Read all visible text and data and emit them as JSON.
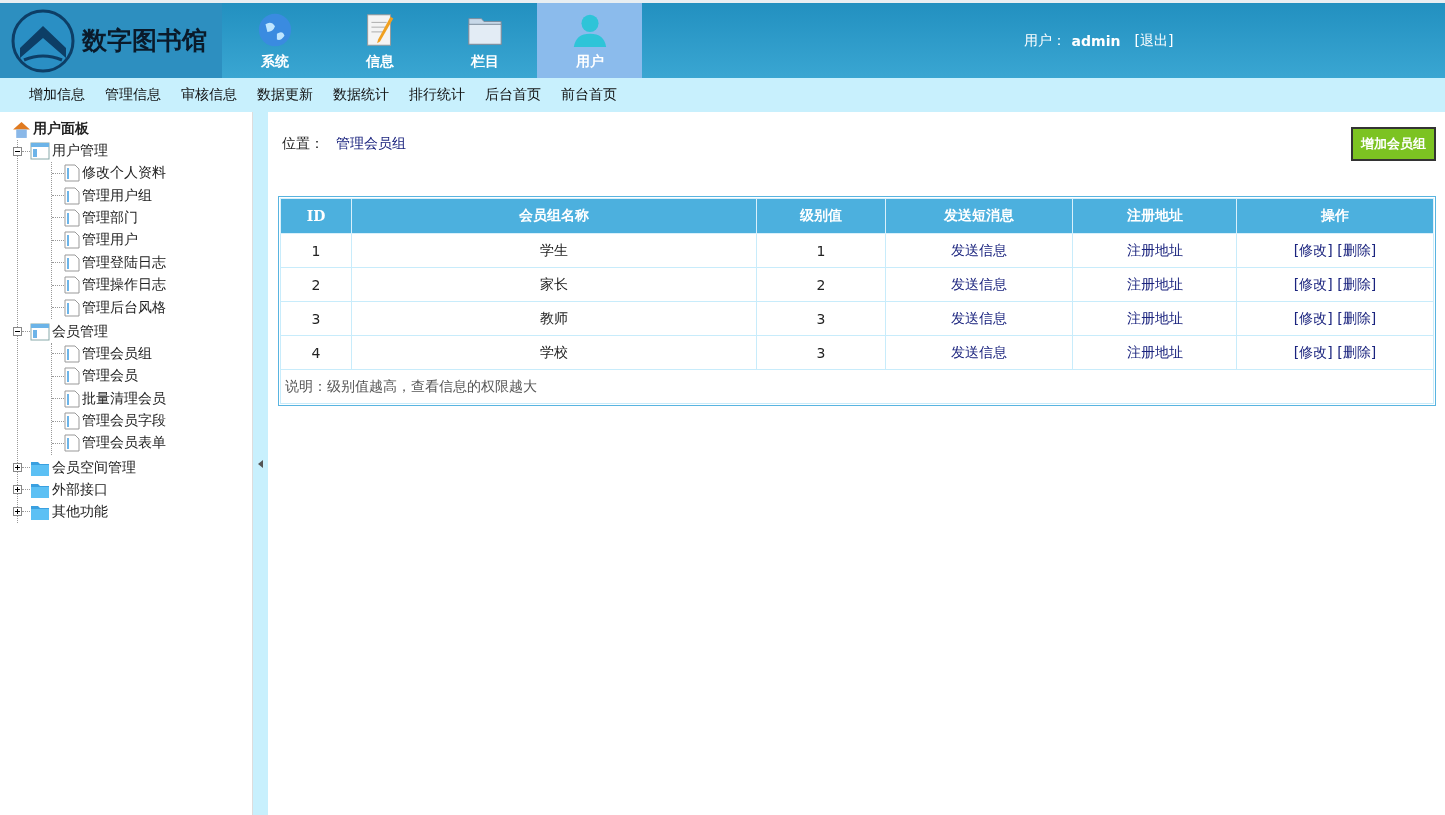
{
  "logo": {
    "title": "数字图书馆"
  },
  "tabs": [
    {
      "label": "系统",
      "kind": "globe",
      "selected": false
    },
    {
      "label": "信息",
      "kind": "note",
      "selected": false
    },
    {
      "label": "栏目",
      "kind": "folder",
      "selected": false
    },
    {
      "label": "用户",
      "kind": "user",
      "selected": true
    }
  ],
  "user": {
    "label": "用户：",
    "name": "admin",
    "logout": "[退出]"
  },
  "subnav": [
    "增加信息",
    "管理信息",
    "审核信息",
    "数据更新",
    "数据统计",
    "排行统计",
    "后台首页",
    "前台首页"
  ],
  "sidebar": {
    "title": "用户面板",
    "tree": [
      {
        "label": "用户管理",
        "kind": "panel",
        "expanded": true,
        "children": [
          {
            "label": "修改个人资料"
          },
          {
            "label": "管理用户组"
          },
          {
            "label": "管理部门"
          },
          {
            "label": "管理用户"
          },
          {
            "label": "管理登陆日志"
          },
          {
            "label": "管理操作日志"
          },
          {
            "label": "管理后台风格"
          }
        ]
      },
      {
        "label": "会员管理",
        "kind": "panel",
        "expanded": true,
        "children": [
          {
            "label": "管理会员组"
          },
          {
            "label": "管理会员"
          },
          {
            "label": "批量清理会员"
          },
          {
            "label": "管理会员字段"
          },
          {
            "label": "管理会员表单"
          }
        ]
      },
      {
        "label": "会员空间管理",
        "kind": "folder",
        "expanded": false
      },
      {
        "label": "外部接口",
        "kind": "folder",
        "expanded": false
      },
      {
        "label": "其他功能",
        "kind": "folder",
        "expanded": false
      }
    ]
  },
  "breadcrumb": {
    "label": "位置：",
    "link": "管理会员组"
  },
  "add_button": "增加会员组",
  "table": {
    "columns": [
      "ID",
      "会员组名称",
      "级别值",
      "发送短消息",
      "注册地址",
      "操作"
    ],
    "rows": [
      {
        "id": "1",
        "name": "学生",
        "level_value": "1",
        "message": "发送信息",
        "register": "注册地址",
        "edit": "[修改]",
        "delete": "[删除]"
      },
      {
        "id": "2",
        "name": "家长",
        "level_value": "2",
        "message": "发送信息",
        "register": "注册地址",
        "edit": "[修改]",
        "delete": "[删除]"
      },
      {
        "id": "3",
        "name": "教师",
        "level_value": "3",
        "message": "发送信息",
        "register": "注册地址",
        "edit": "[修改]",
        "delete": "[删除]"
      },
      {
        "id": "4",
        "name": "学校",
        "level_value": "3",
        "message": "发送信息",
        "register": "注册地址",
        "edit": "[修改]",
        "delete": "[删除]"
      }
    ],
    "note": "说明：级别值越高，查看信息的权限越大"
  }
}
